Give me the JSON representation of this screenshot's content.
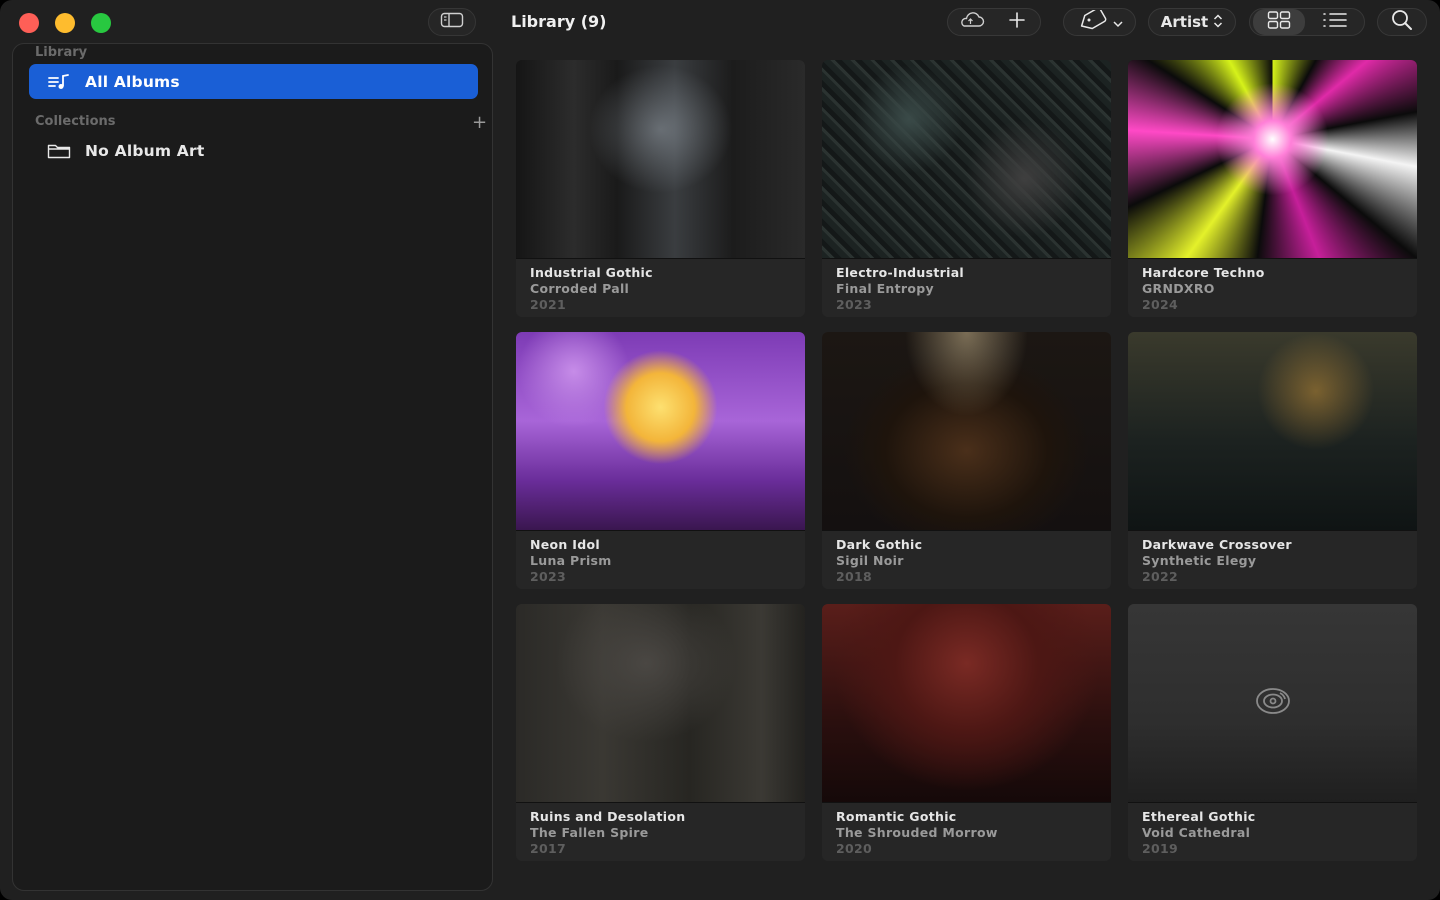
{
  "window": {
    "title": "Library (9)"
  },
  "sidebar": {
    "library_header": "Library",
    "all_albums_label": "All Albums",
    "collections_header": "Collections",
    "collection_items": [
      {
        "label": "No Album Art"
      }
    ]
  },
  "toolbar": {
    "sort_label": "Artist"
  },
  "albums": [
    {
      "genre": "Industrial Gothic",
      "artist": "Corroded Pall",
      "year": "2021"
    },
    {
      "genre": "Electro-Industrial",
      "artist": "Final Entropy",
      "year": "2023"
    },
    {
      "genre": "Hardcore Techno",
      "artist": "GRNDXRO",
      "year": "2024"
    },
    {
      "genre": "Neon Idol",
      "artist": "Luna Prism",
      "year": "2023"
    },
    {
      "genre": "Dark Gothic",
      "artist": "Sigil Noir",
      "year": "2018"
    },
    {
      "genre": "Darkwave Crossover",
      "artist": "Synthetic Elegy",
      "year": "2022"
    },
    {
      "genre": "Ruins and Desolation",
      "artist": "The Fallen Spire",
      "year": "2017"
    },
    {
      "genre": "Romantic Gothic",
      "artist": "The Shrouded Morrow",
      "year": "2020"
    },
    {
      "genre": "Ethereal Gothic",
      "artist": "Void Cathedral",
      "year": "2019"
    }
  ],
  "icons": {
    "sidebar_toggle": "sidebar-icon",
    "cloud": "cloud-icon",
    "add": "plus-icon",
    "tag": "tag-icon",
    "grid_view": "grid-icon",
    "list_view": "list-icon",
    "search": "search-icon",
    "placeholder_art": "disc-icon"
  },
  "colors": {
    "accent": "#1a5fd6",
    "background": "#202020"
  }
}
